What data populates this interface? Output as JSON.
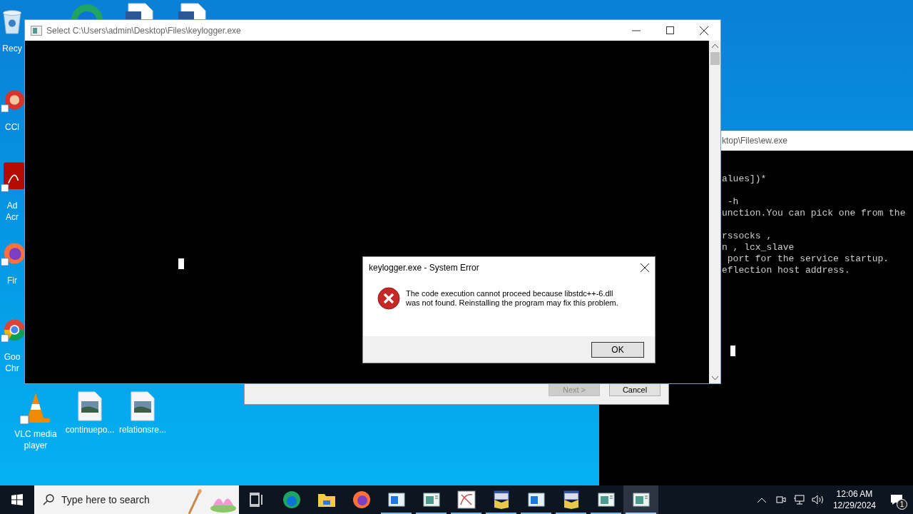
{
  "desktop_icons": [
    {
      "kind": "recycle",
      "label_lines": [
        "Recy"
      ]
    },
    {
      "kind": "ccleaner",
      "label_lines": [
        "CCl"
      ]
    },
    {
      "kind": "acrobat",
      "label_lines": [
        "Ad",
        "Acr"
      ]
    },
    {
      "kind": "firefox",
      "label_lines": [
        "Fir"
      ]
    },
    {
      "kind": "chrome",
      "label_lines": [
        "Goo",
        "Chr"
      ]
    },
    {
      "kind": "vlc",
      "label_lines": [
        "VLC media",
        "player"
      ]
    },
    {
      "kind": "image",
      "label_lines": [
        "continuepo..."
      ]
    },
    {
      "kind": "image",
      "label_lines": [
        "relationsre..."
      ]
    },
    {
      "kind": "edge"
    },
    {
      "kind": "document"
    },
    {
      "kind": "document"
    }
  ],
  "console_window_back": {
    "title": "ktop\\Files\\ew.exe",
    "lines": [
      "alues])*",
      " -h",
      "unction.You can pick one from the",
      "rssocks ,",
      "n , lcx_slave",
      " port for the service startup.",
      "eflection host address."
    ]
  },
  "installer_window": {
    "buttons": [
      {
        "label": "Next >",
        "disabled": true
      },
      {
        "label": "Cancel",
        "disabled": false
      }
    ]
  },
  "console_window": {
    "title": "Select C:\\Users\\admin\\Desktop\\Files\\keylogger.exe"
  },
  "error_dialog": {
    "title": "keylogger.exe - System Error",
    "message": "The code execution cannot proceed because libstdc++-6.dll was not found. Reinstalling the program may fix this problem.",
    "button": "OK"
  },
  "taskbar": {
    "search_placeholder": "Type here to search",
    "apps": [
      {
        "kind": "taskview",
        "running": false,
        "selected": false
      },
      {
        "kind": "edge",
        "running": false,
        "selected": false
      },
      {
        "kind": "explorer",
        "running": false,
        "selected": false
      },
      {
        "kind": "firefox",
        "running": false,
        "selected": false
      },
      {
        "kind": "window",
        "running": true,
        "selected": false
      },
      {
        "kind": "console",
        "running": true,
        "selected": false
      },
      {
        "kind": "paint",
        "running": true,
        "selected": false
      },
      {
        "kind": "installer",
        "running": true,
        "selected": false
      },
      {
        "kind": "window",
        "running": true,
        "selected": false
      },
      {
        "kind": "installer",
        "running": true,
        "selected": false
      },
      {
        "kind": "console",
        "running": true,
        "selected": false
      },
      {
        "kind": "console",
        "running": true,
        "selected": true
      }
    ],
    "time": "12:06 AM",
    "date": "12/29/2024",
    "notification_count": "1"
  }
}
